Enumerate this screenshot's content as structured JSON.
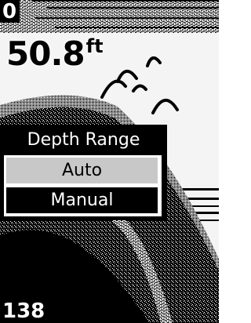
{
  "display": {
    "range_top": "0",
    "range_bottom": "138",
    "depth_value": "50.8",
    "depth_unit": "ft"
  },
  "menu": {
    "title": "Depth Range",
    "options": [
      "Auto",
      "Manual"
    ],
    "selected": "Auto",
    "highlighted": "Manual"
  }
}
